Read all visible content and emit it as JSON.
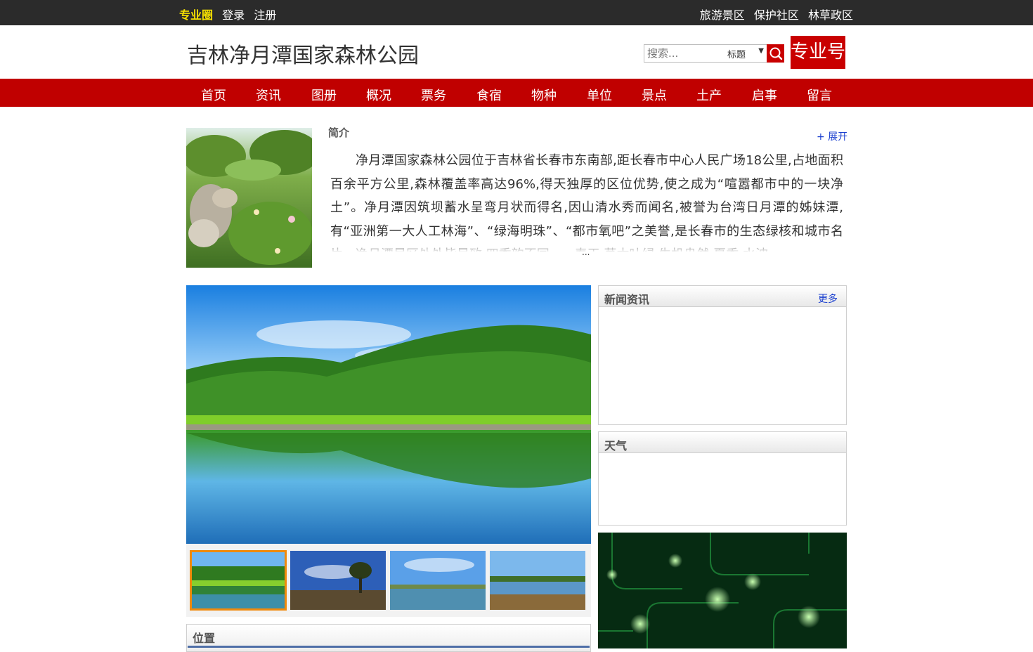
{
  "topbar": {
    "brand": "专业圈",
    "login": "登录",
    "register": "注册",
    "links": [
      "旅游景区",
      "保护社区",
      "林草政区"
    ]
  },
  "header": {
    "title": "吉林净月潭国家森林公园",
    "search_placeholder": "搜索...",
    "search_scope": "标题",
    "badge": "专业号"
  },
  "nav": [
    "首页",
    "资讯",
    "图册",
    "概况",
    "票务",
    "食宿",
    "物种",
    "单位",
    "景点",
    "土产",
    "启事",
    "留言"
  ],
  "intro": {
    "heading": "简介",
    "expand": "+ 展开",
    "text": "净月潭国家森林公园位于吉林省长春市东南部,距长春市中心人民广场18公里,占地面积百余平方公里,森林覆盖率高达96%,得天独厚的区位优势,使之成为“喧嚣都市中的一块净土”。净月潭因筑坝蓄水呈弯月状而得名,因山清水秀而闻名,被誉为台湾日月潭的姊妹潭,有“亚洲第一大人工林海”、“绿海明珠”、“都市氧吧”之美誉,是长春市的生态绿核和城市名片。净月潭景区处处皆景致,四季韵不同——春天,草木吐绿,生机盎然;夏季,水波",
    "ellipsis": "..."
  },
  "panels": {
    "news_title": "新闻资讯",
    "news_more": "更多",
    "weather_title": "天气",
    "location_title": "位置"
  },
  "colors": {
    "topbar": "#2b2b2b",
    "brand_yellow": "#f5e000",
    "nav_red": "#c00000",
    "link_blue": "#1a3fcf",
    "thumb_active": "#f08a0c"
  }
}
